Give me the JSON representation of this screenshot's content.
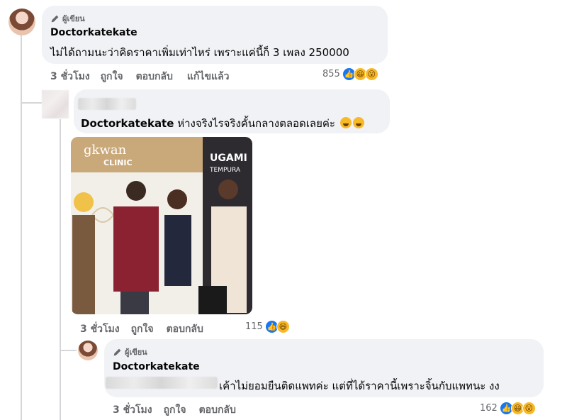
{
  "comments": [
    {
      "author_tag": "ผู้เขียน",
      "author": "Doctorkatekate",
      "text": "ไม่ได้ถามนะว่าคิดราคาเพิ่มเท่าไหร่ เพราะแค่นี้ก็ 3 เพลง 250000",
      "time": "3 ชั่วโมง",
      "like_label": "ถูกใจ",
      "reply_label": "ตอบกลับ",
      "edited_label": "แก้ไขแล้ว",
      "reaction_count": "855",
      "reactions": [
        "like-icon",
        "haha-icon",
        "wow-icon"
      ]
    },
    {
      "mention": "Doctorkatekate",
      "text": "ห่างจริงไรจริงคั้นกลางตลอดเลยค่ะ",
      "time": "3 ชั่วโมง",
      "like_label": "ถูกใจ",
      "reply_label": "ตอบกลับ",
      "reaction_count": "115",
      "reactions": [
        "like-icon",
        "haha-icon"
      ],
      "photo_texts": [
        "gkwan",
        "CLINIC",
        "UGAMI",
        "TEMPURA"
      ]
    },
    {
      "author_tag": "ผู้เขียน",
      "author": "Doctorkatekate",
      "text": "เค้าไม่ยอมยืนติดแพทค่ะ แต่ที่ได้ราคานี้เพราะจิ้นกับแพทนะ งง",
      "time": "3 ชั่วโมง",
      "like_label": "ถูกใจ",
      "reply_label": "ตอบกลับ",
      "reaction_count": "162",
      "reactions": [
        "like-icon",
        "haha-icon",
        "wow-icon"
      ]
    }
  ],
  "colors": {
    "bubble": "#f0f2f5",
    "meta_text": "#65676b",
    "like_blue": "#1877f2",
    "emoji_yellow": "#f7b928"
  }
}
